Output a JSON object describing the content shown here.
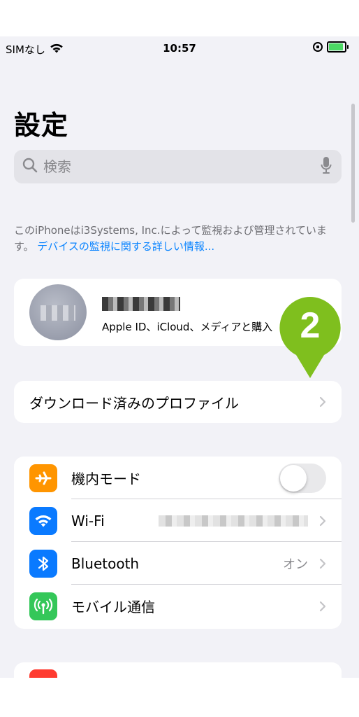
{
  "status_bar": {
    "carrier": "SIMなし",
    "time": "10:57"
  },
  "title": "設定",
  "search": {
    "placeholder": "検索"
  },
  "supervision": {
    "text": "このiPhoneはi3Systems, Inc.によって監視および管理されています。",
    "link": "デバイスの監視に関する詳しい情報..."
  },
  "apple_id": {
    "subtitle": "Apple ID、iCloud、メディアと購入"
  },
  "profile": {
    "label": "ダウンロード済みのプロファイル"
  },
  "connectivity": {
    "airplane": {
      "label": "機内モード",
      "on": false
    },
    "wifi": {
      "label": "Wi-Fi"
    },
    "bluetooth": {
      "label": "Bluetooth",
      "value": "オン"
    },
    "cellular": {
      "label": "モバイル通信"
    }
  },
  "callout": {
    "number": "2"
  },
  "colors": {
    "accent": "#0a84ff",
    "airplane": "#ff9500",
    "wifi": "#0a7aff",
    "bluetooth": "#0a7aff",
    "cellular": "#34c759",
    "callout": "#7fbf1e"
  }
}
